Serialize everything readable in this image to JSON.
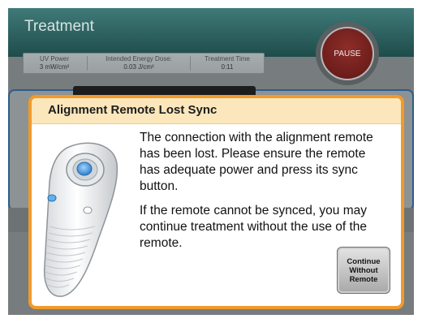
{
  "header": {
    "title": "Treatment"
  },
  "stats": [
    {
      "label": "UV Power",
      "value": "3 mW/cm²"
    },
    {
      "label": "Intended Energy Dose:",
      "value": "0.03 J/cm²"
    },
    {
      "label": "Treatment Time",
      "value": "0:11"
    }
  ],
  "pause": {
    "label": "PAUSE"
  },
  "modal": {
    "title": "Alignment Remote Lost Sync",
    "paragraph1": "The connection with the alignment remote has been lost. Please ensure the remote has adequate power and press its sync button.",
    "paragraph2": "If the remote cannot be synced, you may continue treatment without the use of the remote.",
    "continue_label": "Continue\nWithout\nRemote",
    "image_icon": "alignment-remote-icon"
  },
  "colors": {
    "header": "#2d6665",
    "modal_border": "#f19a2a",
    "modal_header": "#fbe7bb",
    "pause_button": "#7a2420",
    "panel_border": "#2b5c8c"
  }
}
